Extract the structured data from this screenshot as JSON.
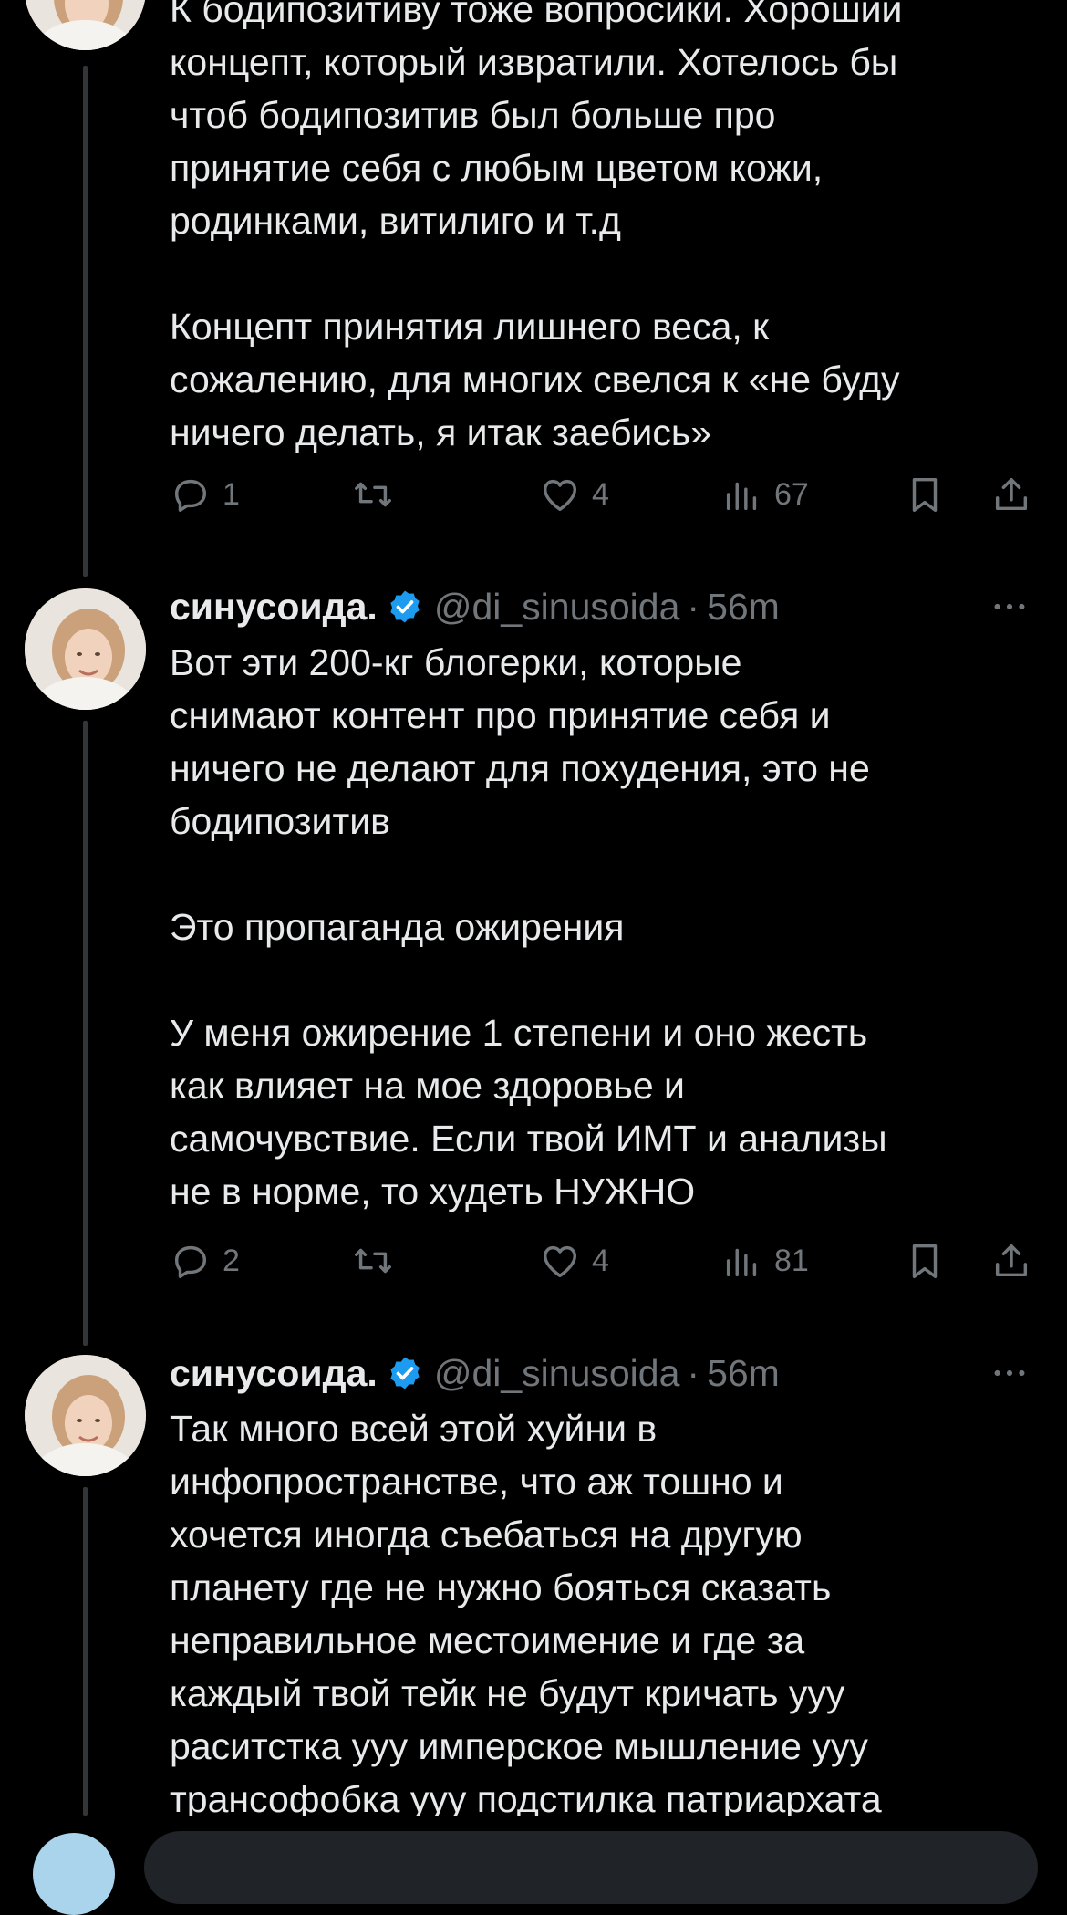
{
  "tweets": [
    {
      "text": "К бодипозитиву тоже вопросики. Хороший\nконцепт, который извратили. Хотелось бы\nчтоб бодипозитив был больше про\nпринятие себя с любым цветом кожи,\nродинками, витилиго и т.д\n\nКонцепт принятия лишнего веса, к\nсожалению, для многих свелся к «не буду\nничего делать, я итак заебись»",
      "replies": "1",
      "likes": "4",
      "views": "67"
    },
    {
      "name": "синусоида.",
      "handle": "@di_sinusoida",
      "separator": "·",
      "time": "56m",
      "text": "Вот эти 200-кг блогерки, которые\nснимают контент про принятие себя и\nничего не делают для похудения, это не\nбодипозитив\n\nЭто пропаганда ожирения\n\nУ меня ожирение 1 степени и оно жесть\nкак влияет на мое здоровье и\nсамочувствие. Если твой ИМТ и анализы\nне в норме, то худеть НУЖНО",
      "replies": "2",
      "likes": "4",
      "views": "81"
    },
    {
      "name": "синусоида.",
      "handle": "@di_sinusoida",
      "separator": "·",
      "time": "56m",
      "text": "Так много всей этой хуйни в\nинфопространстве, что аж тошно и\nхочется иногда съебаться на другую\nпланету где не нужно бояться сказать\nнеправильное местоимение и где за\nкаждый твой тейк не будут кричать ууу\nраситстка ууу имперское мышление ууу\nтрансофобка ууу подстилка патриархата"
    }
  ],
  "colors": {
    "background": "#000000",
    "text": "#e7e9ea",
    "secondary": "#71767b",
    "verified": "#1d9bf0",
    "thread_line": "#333639"
  },
  "icons": [
    "reply-icon",
    "retweet-icon",
    "like-icon",
    "views-icon",
    "bookmark-icon",
    "share-icon",
    "verified-badge-icon",
    "more-icon"
  ]
}
